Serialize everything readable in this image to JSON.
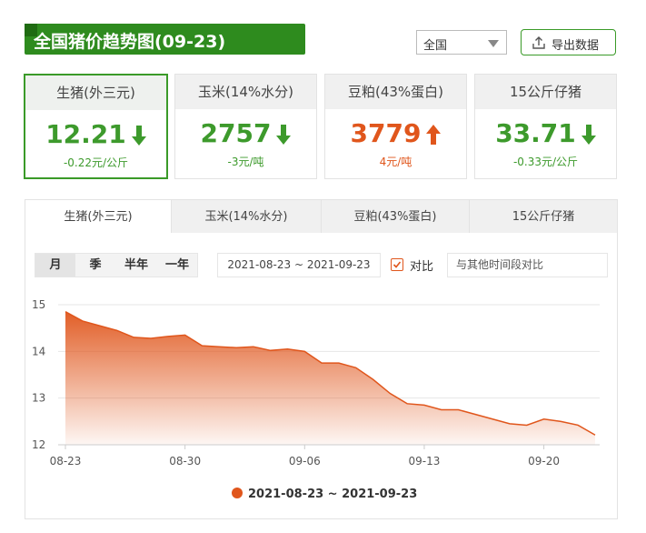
{
  "header": {
    "title": "全国猪价趋势图(09-23)",
    "region_select": {
      "value": "全国"
    },
    "export_label": "导出数据"
  },
  "cards": [
    {
      "name": "生猪(外三元)",
      "value": "12.21",
      "change": "-0.22元/公斤",
      "direction": "down",
      "active": true
    },
    {
      "name": "玉米(14%水分)",
      "value": "2757",
      "change": "-3元/吨",
      "direction": "down",
      "active": false
    },
    {
      "name": "豆粕(43%蛋白)",
      "value": "3779",
      "change": "4元/吨",
      "direction": "up",
      "active": false
    },
    {
      "name": "15公斤仔猪",
      "value": "33.71",
      "change": "-0.33元/公斤",
      "direction": "down",
      "active": false
    }
  ],
  "tabs": [
    "生猪(外三元)",
    "玉米(14%水分)",
    "豆粕(43%蛋白)",
    "15公斤仔猪"
  ],
  "periods": [
    "月",
    "季",
    "半年",
    "一年"
  ],
  "date_range": "2021-08-23 ~ 2021-09-23",
  "compare": {
    "label": "对比",
    "checked": true,
    "placeholder": "与其他时间段对比"
  },
  "colors": {
    "brand_green": "#2e8b1e",
    "down_green": "#3d9a2c",
    "up_red": "#e0561c",
    "series": "#e0561c"
  },
  "chart_data": {
    "type": "area",
    "x": [
      "08-23",
      "08-24",
      "08-25",
      "08-26",
      "08-27",
      "08-28",
      "08-29",
      "08-30",
      "08-31",
      "09-01",
      "09-02",
      "09-03",
      "09-04",
      "09-05",
      "09-06",
      "09-07",
      "09-08",
      "09-09",
      "09-10",
      "09-11",
      "09-12",
      "09-13",
      "09-14",
      "09-15",
      "09-16",
      "09-17",
      "09-18",
      "09-19",
      "09-20",
      "09-21",
      "09-22",
      "09-23"
    ],
    "series": [
      {
        "name": "2021-08-23 ~ 2021-09-23",
        "values": [
          14.85,
          14.65,
          14.55,
          14.45,
          14.3,
          14.28,
          14.32,
          14.35,
          14.12,
          14.1,
          14.08,
          14.1,
          14.02,
          14.05,
          14.0,
          13.75,
          13.75,
          13.65,
          13.4,
          13.1,
          12.88,
          12.85,
          12.75,
          12.75,
          12.65,
          12.55,
          12.45,
          12.42,
          12.55,
          12.5,
          12.42,
          12.21
        ]
      }
    ],
    "xticks": [
      "08-23",
      "08-30",
      "09-06",
      "09-13",
      "09-20"
    ],
    "yticks": [
      12,
      13,
      14,
      15
    ],
    "ylim": [
      12,
      15
    ],
    "grid": true,
    "legend": "bottom"
  }
}
